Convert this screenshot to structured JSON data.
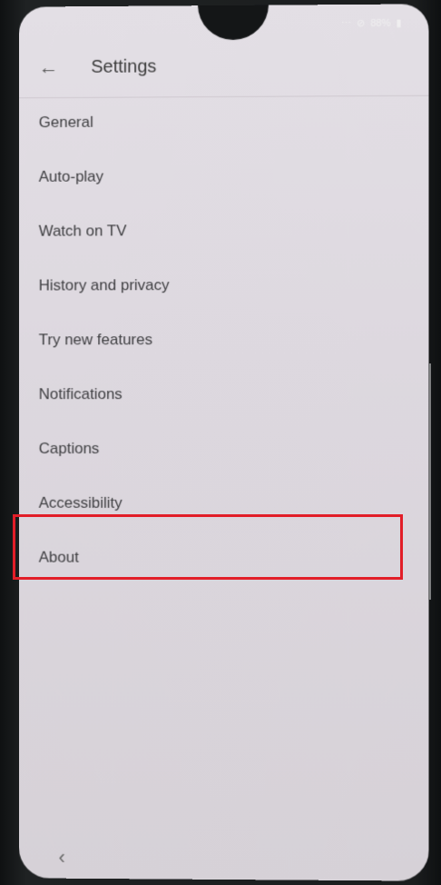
{
  "status_bar": {
    "battery_text": "88%",
    "icons": [
      "signal-icon",
      "dnd-icon",
      "battery-icon"
    ]
  },
  "header": {
    "title": "Settings",
    "back_icon": "back-arrow-icon"
  },
  "menu": {
    "items": [
      {
        "label": "General"
      },
      {
        "label": "Auto-play"
      },
      {
        "label": "Watch on TV"
      },
      {
        "label": "History and privacy"
      },
      {
        "label": "Try new features"
      },
      {
        "label": "Notifications"
      },
      {
        "label": "Captions"
      },
      {
        "label": "Accessibility"
      },
      {
        "label": "About"
      }
    ],
    "highlighted_item": "About"
  },
  "colors": {
    "highlight": "#e21e28",
    "screen_bg": "#ddd8df",
    "text": "#3f3f42"
  },
  "nav": {
    "back_icon": "chevron-left-icon"
  }
}
